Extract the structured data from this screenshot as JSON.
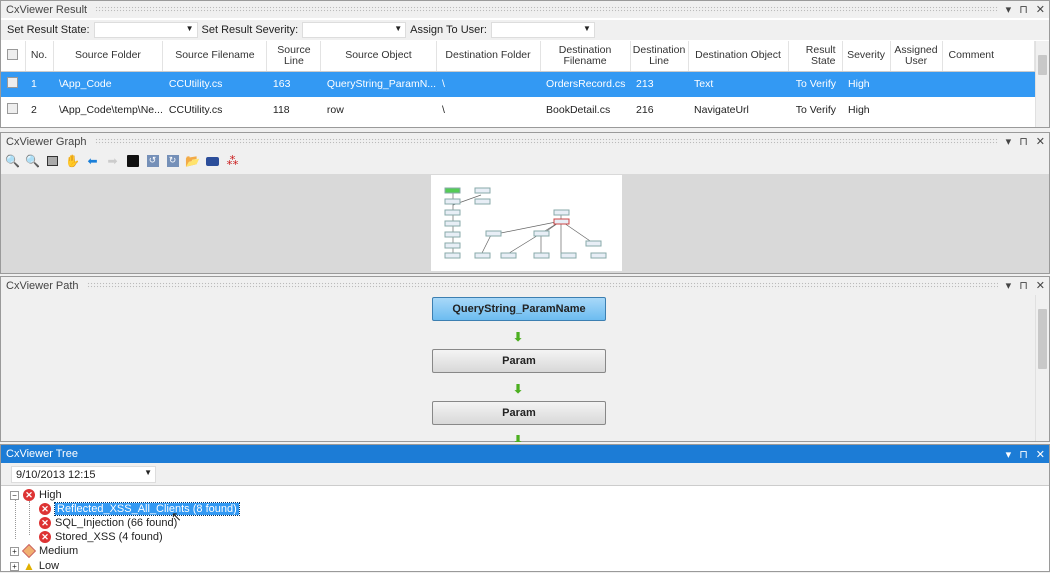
{
  "result": {
    "title": "CxViewer Result",
    "set_state_label": "Set Result State:",
    "set_severity_label": "Set Result Severity:",
    "assign_label": "Assign To User:",
    "columns": [
      "No.",
      "Source Folder",
      "Source Filename",
      "Source Line",
      "Source Object",
      "Destination Folder",
      "Destination Filename",
      "Destination Line",
      "Destination Object",
      "Result State",
      "Severity",
      "Assigned User",
      "Comment"
    ],
    "rows": [
      [
        "1",
        "\\App_Code",
        "CCUtility.cs",
        "163",
        "QueryString_ParamN...",
        "\\",
        "OrdersRecord.cs",
        "213",
        "Text",
        "To Verify",
        "High",
        "",
        ""
      ],
      [
        "2",
        "\\App_Code\\temp\\Ne...",
        "CCUtility.cs",
        "118",
        "row",
        "\\",
        "BookDetail.cs",
        "216",
        "NavigateUrl",
        "To Verify",
        "High",
        "",
        ""
      ]
    ]
  },
  "graph": {
    "title": "CxViewer Graph",
    "tools": [
      "zoom-in",
      "zoom-out",
      "fit",
      "pan",
      "back",
      "forward",
      "save",
      "undo",
      "redo",
      "open",
      "print",
      "layout"
    ]
  },
  "path": {
    "title": "CxViewer Path",
    "nodes": [
      "QueryString_ParamName",
      "Param",
      "Param"
    ]
  },
  "tree": {
    "title": "CxViewer Tree",
    "scan_date": "9/10/2013 12:15",
    "groups": [
      {
        "label": "High",
        "children": [
          "Reflected_XSS_All_Clients (8 found)",
          "SQL_Injection (66 found)",
          "Stored_XSS (4 found)"
        ]
      },
      {
        "label": "Medium"
      },
      {
        "label": "Low"
      }
    ]
  },
  "window_controls": {
    "menu": "▾",
    "pin": "⊓",
    "close": "✕"
  }
}
